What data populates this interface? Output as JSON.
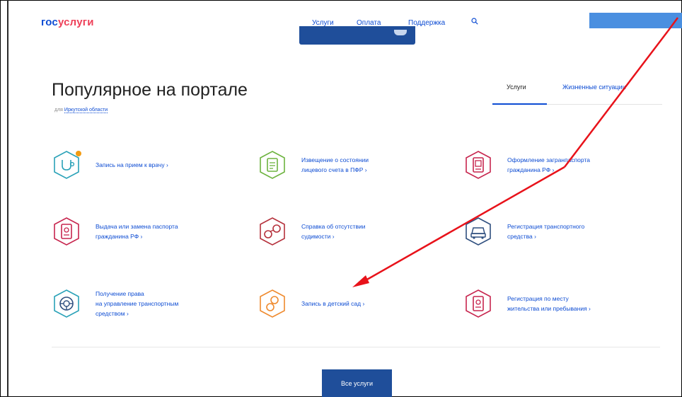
{
  "header": {
    "logo_part1": "гос",
    "logo_part2": "услуги",
    "nav": [
      "Услуги",
      "Оплата",
      "Поддержка"
    ]
  },
  "section": {
    "title": "Популярное на портале",
    "region_prefix": "для",
    "region_link": "Иркутской области",
    "tabs": [
      "Услуги",
      "Жизненные ситуации"
    ]
  },
  "services": [
    {
      "lines": [
        "Запись на прием к врачу ›"
      ],
      "icon": "stethoscope-icon",
      "color": "#2aa2b8",
      "badge": true
    },
    {
      "lines": [
        "Извещение о состоянии",
        "лицевого счета в ПФР ›"
      ],
      "icon": "document-icon",
      "color": "#6db33f"
    },
    {
      "lines": [
        "Оформление загранпаспорта",
        "гражданина РФ ›"
      ],
      "icon": "passport-icon",
      "color": "#c7254e"
    },
    {
      "lines": [
        "Выдача или замена паспорта",
        "гражданина РФ ›"
      ],
      "icon": "passport-icon",
      "color": "#c7254e"
    },
    {
      "lines": [
        "Справка об отсутствии",
        "судимости ›"
      ],
      "icon": "handcuffs-icon",
      "color": "#b5313c"
    },
    {
      "lines": [
        "Регистрация транспортного",
        "средства ›"
      ],
      "icon": "car-icon",
      "color": "#2f4f7f"
    },
    {
      "lines": [
        "Получение права",
        "на управление транспортным",
        "средством ›"
      ],
      "icon": "steering-wheel-icon",
      "color": "#2aa2b8"
    },
    {
      "lines": [
        "Запись в детский сад ›"
      ],
      "icon": "rattle-icon",
      "color": "#ef8a2e"
    },
    {
      "lines": [
        "Регистрация по месту",
        "жительства или пребывания ›"
      ],
      "icon": "passport-icon",
      "color": "#c7254e"
    }
  ],
  "all_services_label": "Все услуги",
  "annotation_color": "#e8121a"
}
